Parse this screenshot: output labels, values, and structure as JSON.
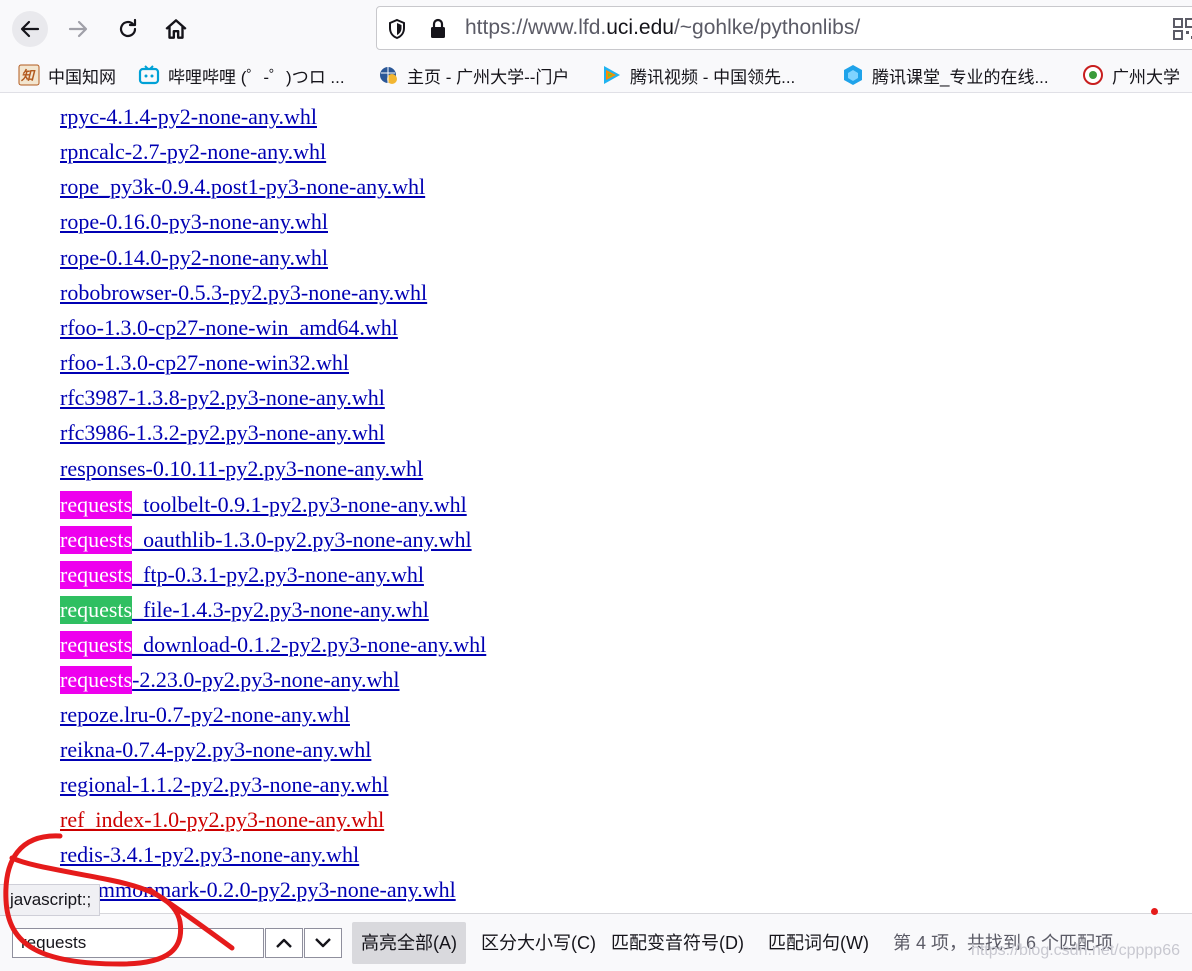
{
  "browser": {
    "url_prefix": "https://www.lfd.",
    "url_domain": "uci.edu",
    "url_path": "/~gohlke/pythonlibs/"
  },
  "bookmarks": [
    {
      "label": "中国知网",
      "icon": "cnki-icon"
    },
    {
      "label": "哔哩哔哩 (゜-゜)つロ ...",
      "icon": "bilibili-icon"
    },
    {
      "label": "主页 - 广州大学--门户",
      "icon": "globe-icon"
    },
    {
      "label": "腾讯视频 - 中国领先...",
      "icon": "tencent-video-icon"
    },
    {
      "label": "腾讯课堂_专业的在线...",
      "icon": "tencent-class-icon"
    },
    {
      "label": "广州大学",
      "icon": "gzhu-icon"
    }
  ],
  "packages": [
    {
      "text": "rpyc-4.1.4-py2-none-any.whl"
    },
    {
      "text": "rpncalc-2.7-py2-none-any.whl"
    },
    {
      "text": "rope_py3k-0.9.4.post1-py3-none-any.whl"
    },
    {
      "text": "rope-0.16.0-py3-none-any.whl"
    },
    {
      "text": "rope-0.14.0-py2-none-any.whl"
    },
    {
      "text": "robobrowser-0.5.3-py2.py3-none-any.whl"
    },
    {
      "text": "rfoo-1.3.0-cp27-none-win_amd64.whl"
    },
    {
      "text": "rfoo-1.3.0-cp27-none-win32.whl"
    },
    {
      "text": "rfc3987-1.3.8-py2.py3-none-any.whl"
    },
    {
      "text": "rfc3986-1.3.2-py2.py3-none-any.whl"
    },
    {
      "text": "responses-0.10.11-py2.py3-none-any.whl"
    },
    {
      "match": "requests",
      "rest": "_toolbelt-0.9.1-py2.py3-none-any.whl"
    },
    {
      "match": "requests",
      "rest": "_oauthlib-1.3.0-py2.py3-none-any.whl"
    },
    {
      "match": "requests",
      "rest": "_ftp-0.3.1-py2.py3-none-any.whl"
    },
    {
      "match": "requests",
      "rest": "_file-1.4.3-py2.py3-none-any.whl",
      "current": true
    },
    {
      "match": "requests",
      "rest": "_download-0.1.2-py2.py3-none-any.whl"
    },
    {
      "match": "requests",
      "rest": "-2.23.0-py2.py3-none-any.whl"
    },
    {
      "text": "repoze.lru-0.7-py2-none-any.whl"
    },
    {
      "text": "reikna-0.7.4-py2.py3-none-any.whl"
    },
    {
      "text": "regional-1.1.2-py2.py3-none-any.whl"
    },
    {
      "text": "ref_index-1.0-py2.py3-none-any.whl",
      "visited": true
    },
    {
      "text": "redis-3.4.1-py2.py3-none-any.whl"
    },
    {
      "text": "recommonmark-0.2.0-py2.py3-none-any.whl"
    }
  ],
  "status_text": "javascript:;",
  "findbar": {
    "query": "requests",
    "highlight_all": "高亮全部(A)",
    "match_case": "区分大小写(C)",
    "match_diacritics": "匹配变音符号(D)",
    "whole_words": "匹配词句(W)",
    "match_count": "第 4 项，共找到 6 个匹配项"
  },
  "watermark": "https://blog.csdn.net/cpppp66",
  "colors": {
    "link": "#0000b3",
    "visited_link": "#cc0000",
    "highlight": "#ee00ee",
    "current_highlight": "#2fbf61"
  }
}
